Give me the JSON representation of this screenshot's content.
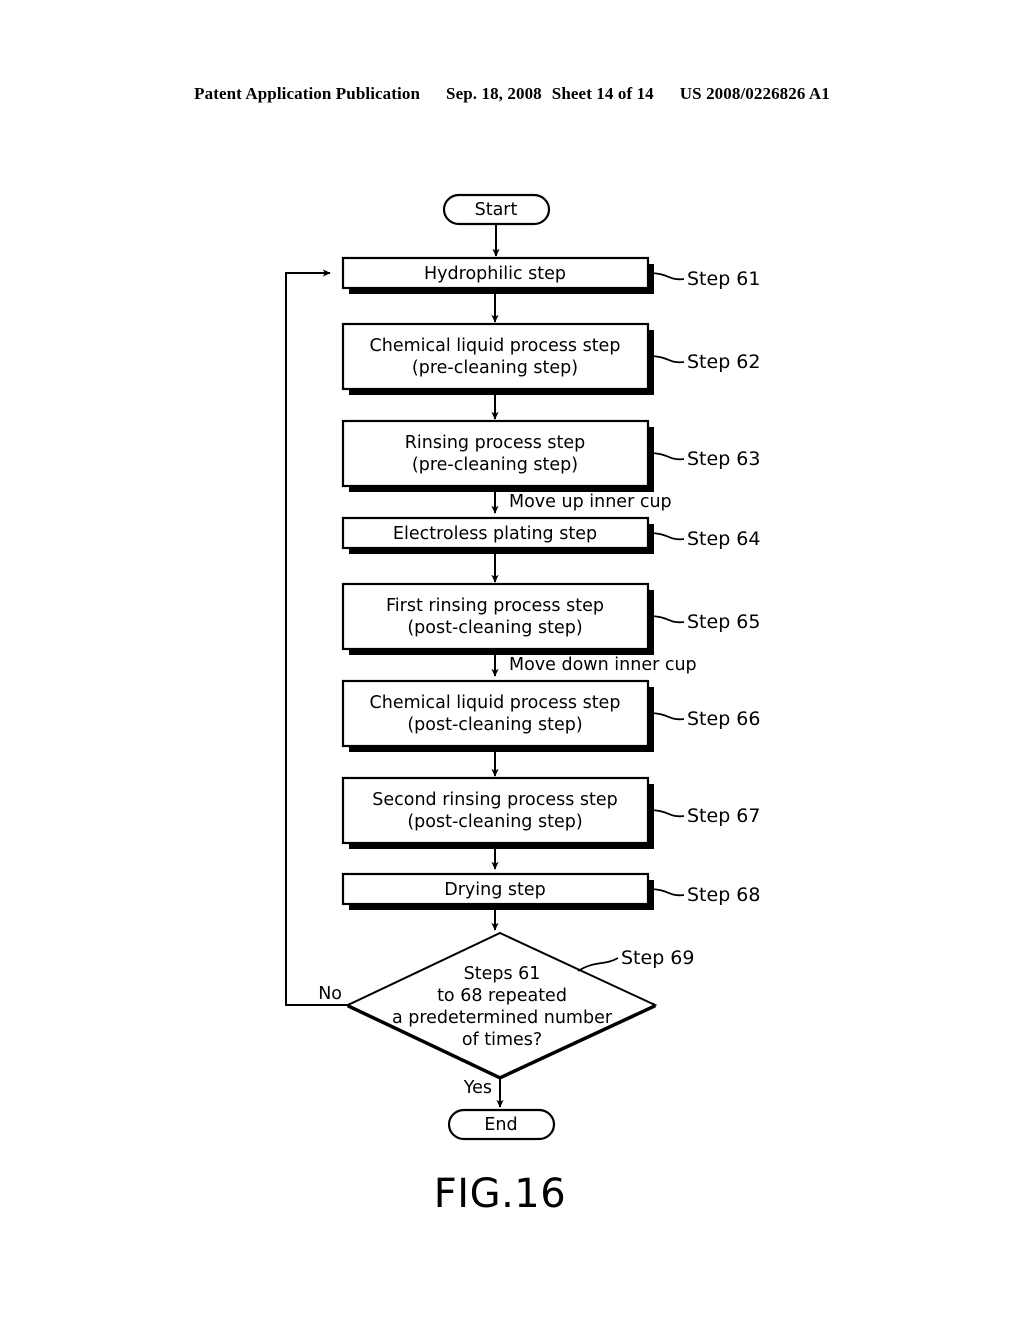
{
  "header": {
    "publication": "Patent Application Publication",
    "date": "Sep. 18, 2008",
    "sheet": "Sheet 14 of 14",
    "patent_number": "US 2008/0226826 A1"
  },
  "figure": {
    "caption": "FIG.16",
    "start_label": "Start",
    "end_label": "End",
    "yes_label": "Yes",
    "no_label": "No",
    "annotations": [
      {
        "id": "move-up",
        "text": "Move up inner cup"
      },
      {
        "id": "move-down",
        "text": "Move down inner cup"
      }
    ],
    "steps": [
      {
        "id": "step-61",
        "ref": "Step 61",
        "lines": [
          "Hydrophilic step"
        ]
      },
      {
        "id": "step-62",
        "ref": "Step 62",
        "lines": [
          "Chemical liquid process step",
          "(pre-cleaning step)"
        ]
      },
      {
        "id": "step-63",
        "ref": "Step 63",
        "lines": [
          "Rinsing process step",
          "(pre-cleaning step)"
        ]
      },
      {
        "id": "step-64",
        "ref": "Step 64",
        "lines": [
          "Electroless plating step"
        ]
      },
      {
        "id": "step-65",
        "ref": "Step 65",
        "lines": [
          "First rinsing process step",
          "(post-cleaning step)"
        ]
      },
      {
        "id": "step-66",
        "ref": "Step 66",
        "lines": [
          "Chemical liquid process step",
          "(post-cleaning step)"
        ]
      },
      {
        "id": "step-67",
        "ref": "Step 67",
        "lines": [
          "Second rinsing process step",
          "(post-cleaning step)"
        ]
      },
      {
        "id": "step-68",
        "ref": "Step 68",
        "lines": [
          "Drying step"
        ]
      }
    ],
    "decision": {
      "id": "step-69",
      "ref": "Step 69",
      "lines": [
        "Steps 61",
        "to 68 repeated",
        "a predetermined number",
        "of times?"
      ]
    }
  },
  "colors": {
    "ink": "#000000",
    "paper": "#ffffff"
  }
}
